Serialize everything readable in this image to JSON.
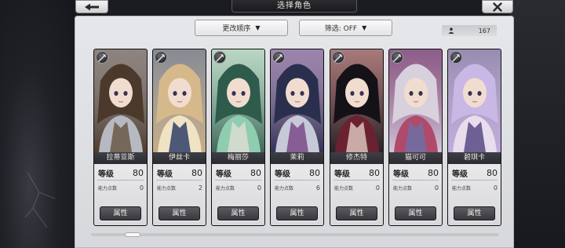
{
  "header": {
    "title": "选择角色",
    "back_icon": "back-arrow-icon",
    "close_icon": "close-x-icon"
  },
  "toolbar": {
    "sort_label": "更改顺序",
    "filter_label": "筛选: OFF",
    "dropdown_icon": "triangle-down-icon",
    "count_icon": "person-icon",
    "count": "167"
  },
  "labels": {
    "level": "等级",
    "ability_points": "能力点数",
    "attribute_button": "属性"
  },
  "characters": [
    {
      "name": "拉蒂亚斯",
      "level": "80",
      "ability_points": "0",
      "palette": [
        "#4b3a2c",
        "#b7b9c2",
        "#6a5847"
      ]
    },
    {
      "name": "伊丝卡",
      "level": "80",
      "ability_points": "2",
      "palette": [
        "#d6b98a",
        "#efe3c4",
        "#30406a"
      ]
    },
    {
      "name": "梅丽莎",
      "level": "80",
      "ability_points": "0",
      "palette": [
        "#2f5b4c",
        "#8fcdb0",
        "#dcdcd2"
      ]
    },
    {
      "name": "茉莉",
      "level": "80",
      "ability_points": "6",
      "palette": [
        "#2b2f4e",
        "#c7c9d8",
        "#7a4a8a"
      ]
    },
    {
      "name": "修杰特",
      "level": "80",
      "ability_points": "0",
      "palette": [
        "#141216",
        "#6a2230",
        "#d9c2b8"
      ]
    },
    {
      "name": "猫可可",
      "level": "80",
      "ability_points": "0",
      "palette": [
        "#d9d0de",
        "#b04a6a",
        "#6f6fa6"
      ]
    },
    {
      "name": "碧琪卡",
      "level": "80",
      "ability_points": "0",
      "palette": [
        "#c9b7e6",
        "#e8dced",
        "#574a82"
      ]
    }
  ]
}
